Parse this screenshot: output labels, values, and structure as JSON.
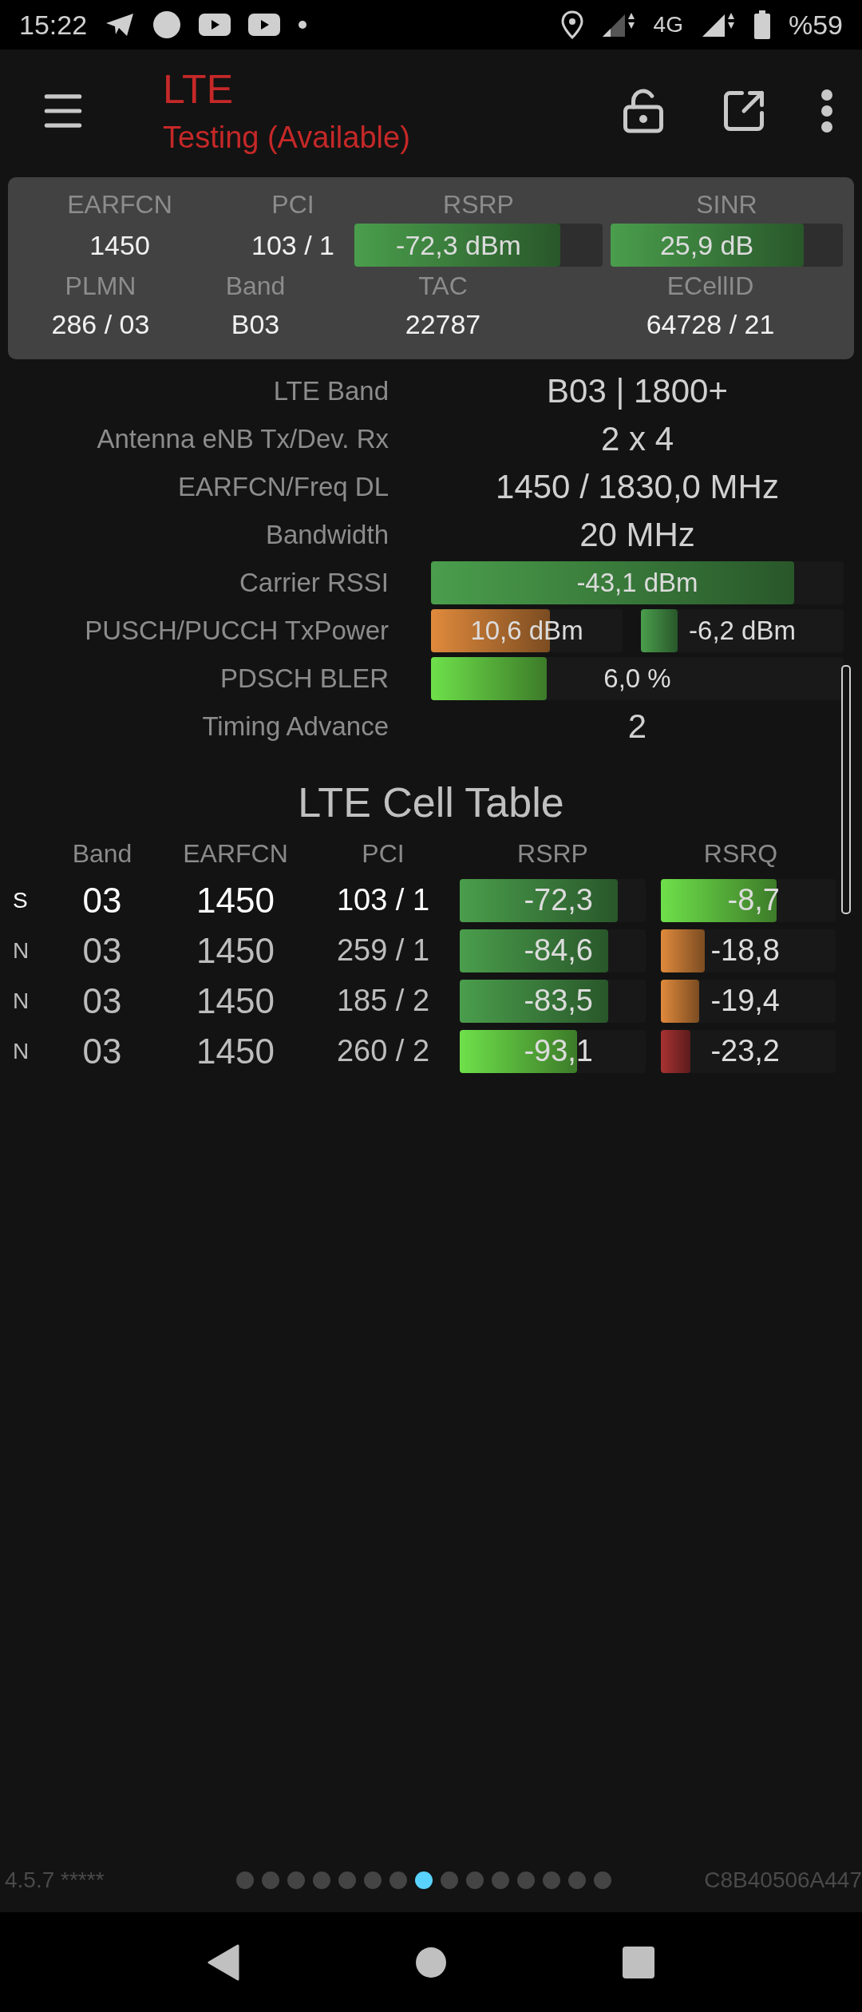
{
  "status_bar": {
    "time": "15:22",
    "network": "4G",
    "battery": "%59"
  },
  "app_bar": {
    "title": "LTE",
    "subtitle": "Testing (Available)"
  },
  "summary": {
    "top": [
      {
        "kind": "text",
        "label": "EARFCN",
        "value": "1450"
      },
      {
        "kind": "text",
        "label": "PCI",
        "value": "103 / 1"
      },
      {
        "kind": "bar",
        "label": "RSRP",
        "value": "-72,3 dBm",
        "level": 0.83,
        "color": "#4a9e4c"
      },
      {
        "kind": "bar",
        "label": "SINR",
        "value": "25,9 dB",
        "level": 0.83,
        "color": "#4a9e4c"
      }
    ],
    "bottom": [
      {
        "label": "PLMN",
        "value": "286 / 03"
      },
      {
        "label": "Band",
        "value": "B03"
      },
      {
        "label": "TAC",
        "value": "22787"
      },
      {
        "label": "ECellID",
        "value": "64728 / 21"
      }
    ]
  },
  "details": [
    {
      "kind": "text",
      "label": "LTE Band",
      "value": "B03 | 1800+"
    },
    {
      "kind": "text",
      "label": "Antenna eNB Tx/Dev. Rx",
      "value": "2 x 4"
    },
    {
      "kind": "text",
      "label": "EARFCN/Freq DL",
      "value": "1450 / 1830,0 MHz"
    },
    {
      "kind": "text",
      "label": "Bandwidth",
      "value": "20 MHz"
    },
    {
      "kind": "bar",
      "label": "Carrier RSSI",
      "bars": [
        {
          "value": "-43,1 dBm",
          "level": 0.88,
          "color": "#4a9e4c"
        }
      ]
    },
    {
      "kind": "bar",
      "label": "PUSCH/PUCCH TxPower",
      "bars": [
        {
          "value": "10,6 dBm",
          "level": 0.62,
          "color": "#e08a3c"
        },
        {
          "value": "-6,2 dBm",
          "level": 0.18,
          "color": "#4a9e4c"
        }
      ]
    },
    {
      "kind": "bar",
      "label": "PDSCH BLER",
      "bars": [
        {
          "value": "6,0 %",
          "level": 0.28,
          "color": "#6ee04a"
        }
      ]
    },
    {
      "kind": "text",
      "label": "Timing Advance",
      "value": "2"
    }
  ],
  "cell_table": {
    "title": "LTE Cell Table",
    "columns": [
      "Band",
      "EARFCN",
      "PCI",
      "RSRP",
      "RSRQ"
    ],
    "rows": [
      {
        "type": "S",
        "serving": true,
        "band": "03",
        "earfcn": "1450",
        "pci": "103 / 1",
        "rsrp": {
          "value": "-72,3",
          "level": 0.85,
          "color": "#4a9e4c"
        },
        "rsrq": {
          "value": "-8,7",
          "level": 0.66,
          "color": "#6ee04a"
        }
      },
      {
        "type": "N",
        "serving": false,
        "band": "03",
        "earfcn": "1450",
        "pci": "259 / 1",
        "rsrp": {
          "value": "-84,6",
          "level": 0.8,
          "color": "#4a9e4c"
        },
        "rsrq": {
          "value": "-18,8",
          "level": 0.25,
          "color": "#e08a3c"
        }
      },
      {
        "type": "N",
        "serving": false,
        "band": "03",
        "earfcn": "1450",
        "pci": "185 / 2",
        "rsrp": {
          "value": "-83,5",
          "level": 0.8,
          "color": "#4a9e4c"
        },
        "rsrq": {
          "value": "-19,4",
          "level": 0.22,
          "color": "#e08a3c"
        }
      },
      {
        "type": "N",
        "serving": false,
        "band": "03",
        "earfcn": "1450",
        "pci": "260 / 2",
        "rsrp": {
          "value": "-93,1",
          "level": 0.63,
          "color": "#6ee04a"
        },
        "rsrq": {
          "value": "-23,2",
          "level": 0.17,
          "color": "#a83232"
        }
      }
    ]
  },
  "footer": {
    "version": "4.5.7 *****",
    "device_id": "C8B40506A447",
    "pager": [
      {
        "selected": false
      },
      {
        "selected": false
      },
      {
        "selected": false
      },
      {
        "selected": false
      },
      {
        "selected": false
      },
      {
        "selected": false
      },
      {
        "selected": false
      },
      {
        "selected": true
      },
      {
        "selected": false
      },
      {
        "selected": false
      },
      {
        "selected": false
      },
      {
        "selected": false
      },
      {
        "selected": false
      },
      {
        "selected": false
      },
      {
        "selected": false
      }
    ]
  }
}
